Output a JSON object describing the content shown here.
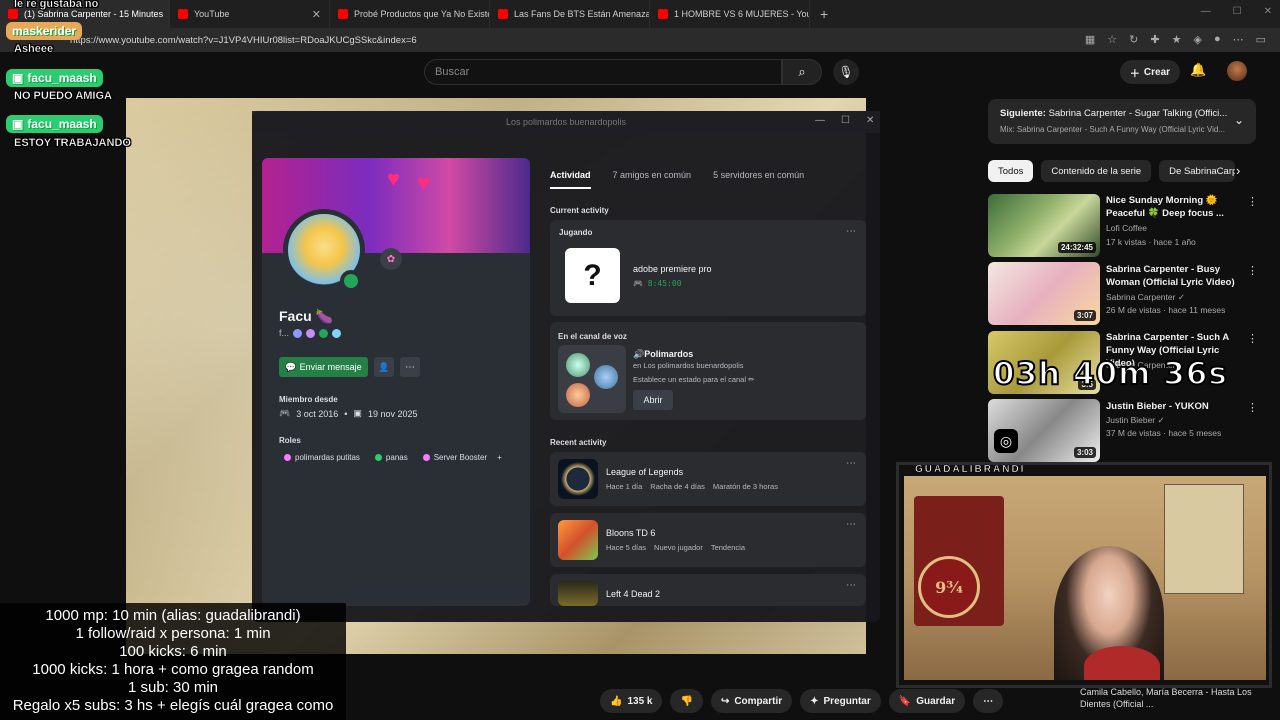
{
  "browser": {
    "tabs": [
      {
        "label": "(1) Sabrina Carpenter - 15 Minutes",
        "active": true
      },
      {
        "label": "YouTube"
      },
      {
        "label": "Probé Productos que Ya No Existen"
      },
      {
        "label": "Las Fans De BTS Están Amenazando"
      },
      {
        "label": "1 HOMBRE VS 6 MUJERES - YouTube"
      }
    ],
    "url": "https://www.youtube.com/watch?v=J1VP4VHIUr08list=RDoaJKUCgSSkc&index=6"
  },
  "youtube": {
    "search_placeholder": "Buscar",
    "create_label": "Crear",
    "next_up": {
      "label": "Siguiente:",
      "title": "Sabrina Carpenter - Sugar Talking (Offici...",
      "mix": "Mix: Sabrina Carpenter - Such A Funny Way (Official Lyric Vid..."
    },
    "chips": [
      "Todos",
      "Contenido de la serie",
      "De SabrinaCarp"
    ],
    "recommended": [
      {
        "title": "Nice Sunday Morning 🌞 Peaceful 🍀 Deep focus ...",
        "channel": "Lofi Coffee",
        "meta": "17 k vistas · hace 1 año",
        "duration": "24:32:45"
      },
      {
        "title": "Sabrina Carpenter - Busy Woman (Official Lyric Video)",
        "channel": "Sabrina Carpenter ✓",
        "meta": "26 M de vistas · hace 11 meses",
        "duration": "3:07"
      },
      {
        "title": "Sabrina Carpenter - Such A Funny Way (Official Lyric Video)",
        "channel": "Sabrina Carpenter",
        "meta": "",
        "duration": "3:5"
      },
      {
        "title": "Justin Bieber - YUKON",
        "channel": "Justin Bieber ✓",
        "meta": "37 M de vistas · hace 5 meses",
        "duration": "3:03"
      }
    ],
    "bottom_next": "Camila Cabello, María Becerra - Hasta Los Dientes (Official ...",
    "actions": {
      "likes": "135 k",
      "share": "Compartir",
      "ask": "Preguntar",
      "save": "Guardar"
    }
  },
  "discord": {
    "window_title": "Los polimardos buenardopolis",
    "profile": {
      "name": "Facu 🍆",
      "tag": "f...",
      "send_message": "Enviar mensaje",
      "member_since_label": "Miembro desde",
      "member_since_discord": "3 oct 2016",
      "member_since_server": "19 nov 2025",
      "roles_label": "Roles",
      "roles": [
        {
          "name": "polimardas putitas",
          "color": "#f47fff"
        },
        {
          "name": "panas",
          "color": "#2ecc71"
        },
        {
          "name": "Server Booster",
          "color": "#f47fff"
        }
      ]
    },
    "tabs": [
      "Actividad",
      "7 amigos en común",
      "5 servidores en común"
    ],
    "current_activity_label": "Current activity",
    "playing": {
      "label": "Jugando",
      "game": "adobe premiere pro",
      "time": "8:45:00"
    },
    "voice": {
      "label": "En el canal de voz",
      "channel": "🔊Polimardos",
      "server": "en Los polimardos buenardopolis",
      "status_hint": "Establece un estado para el canal ✏",
      "open": "Abrir"
    },
    "recent_activity_label": "Recent activity",
    "recent": [
      {
        "game": "League of Legends",
        "meta": [
          "Hace 1 día",
          "Racha de 4 días",
          "Maratón de 3 horas"
        ]
      },
      {
        "game": "Bloons TD 6",
        "meta": [
          "Hace 5 días",
          "Nuevo jugador",
          "Tendencia"
        ]
      },
      {
        "game": "Left 4 Dead 2",
        "meta": []
      }
    ]
  },
  "stream": {
    "chat": [
      {
        "type": "text",
        "text": "le re gustaba no"
      },
      {
        "type": "user",
        "text": "maskerider"
      },
      {
        "type": "text",
        "text": "Asheee"
      },
      {
        "type": "user",
        "text": "facu_maash"
      },
      {
        "type": "text",
        "text": "NO PUEDO AMIGA"
      },
      {
        "type": "user",
        "text": "facu_maash"
      },
      {
        "type": "text",
        "text": "ESTOY TRABAJANDO"
      }
    ],
    "timer": "03h 40m 36s",
    "cam_label": "GUADALIBRANDI",
    "goals": [
      "1000 mp: 10 min (alias: guadalibrandi)",
      "1 follow/raid x persona: 1 min",
      "100 kicks: 6 min",
      "1000 kicks: 1 hora + como gragea random",
      "1 sub: 30 min",
      "Regalo x5 subs: 3 hs + elegís cuál gragea como"
    ]
  }
}
